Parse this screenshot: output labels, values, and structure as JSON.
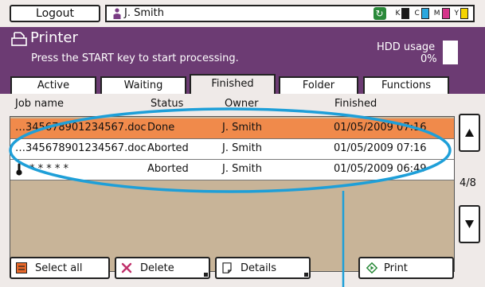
{
  "topbar": {
    "logout_label": "Logout",
    "user_name": "J. Smith",
    "toner": [
      {
        "label": "K",
        "color": "#1a1a1a"
      },
      {
        "label": "C",
        "color": "#2aa8e0"
      },
      {
        "label": "M",
        "color": "#d6338a"
      },
      {
        "label": "Y",
        "color": "#f5d400"
      }
    ]
  },
  "header": {
    "title": "Printer",
    "message": "Press the START key to start processing.",
    "hdd_label": "HDD usage",
    "hdd_value": "0%"
  },
  "tabs": [
    {
      "label": "Active"
    },
    {
      "label": "Waiting"
    },
    {
      "label": "Finished"
    },
    {
      "label": "Folder"
    },
    {
      "label": "Functions"
    }
  ],
  "columns": {
    "job_name": "Job name",
    "status": "Status",
    "owner": "Owner",
    "finished": "Finished"
  },
  "jobs": [
    {
      "name": "…345678901234567.doc",
      "status": "Done",
      "owner": "J. Smith",
      "finished": "01/05/2009 07:16"
    },
    {
      "name": "…345678901234567.doc",
      "status": "Aborted",
      "owner": "J. Smith",
      "finished": "01/05/2009 07:16"
    },
    {
      "name": "* * * * *",
      "status": "Aborted",
      "owner": "J. Smith",
      "finished": "01/05/2009 06:49"
    }
  ],
  "pager": {
    "indicator": "4/8"
  },
  "buttons": {
    "select_all": "Select all",
    "delete": "Delete",
    "details": "Details",
    "print": "Print"
  },
  "colors": {
    "header_bg": "#6c3b73",
    "selected_row": "#f08a4b",
    "callout": "#1e9fd8",
    "list_bg": "#efeae8",
    "empty_rows": "#c8b498"
  }
}
